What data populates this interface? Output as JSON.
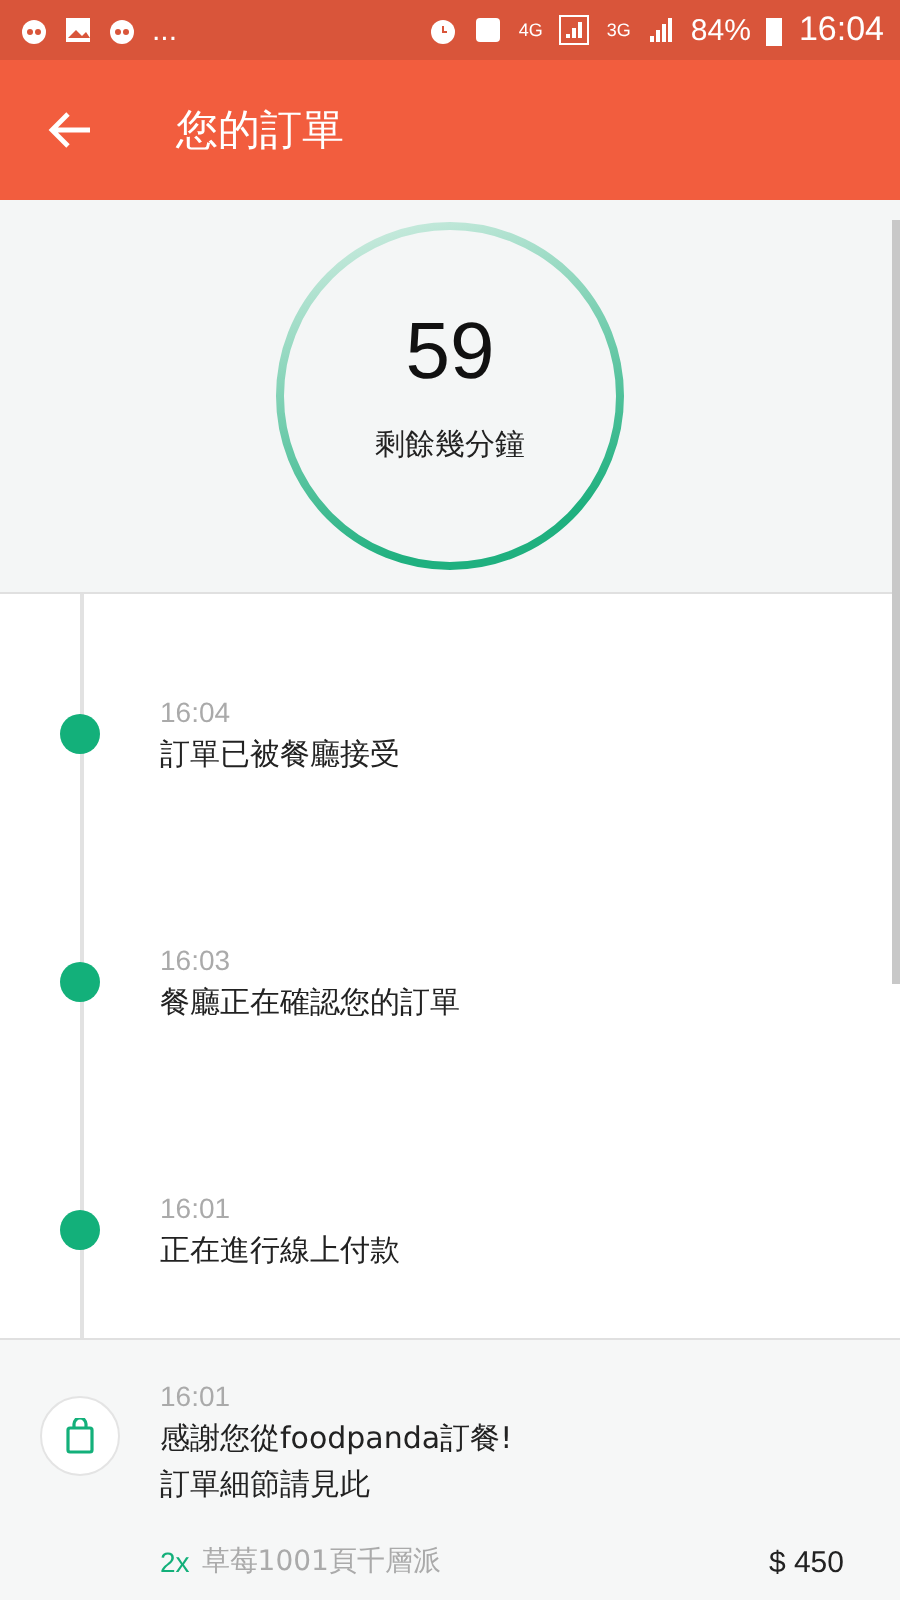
{
  "status_bar": {
    "overflow": "...",
    "network_4g": "4G",
    "network_3g": "3G",
    "battery": "84%",
    "time": "16:04"
  },
  "app_bar": {
    "title": "您的訂單"
  },
  "countdown": {
    "minutes": "59",
    "caption": "剩餘幾分鐘"
  },
  "timeline": [
    {
      "kind": "status",
      "time": "16:04",
      "text": "訂單已被餐廳接受"
    },
    {
      "kind": "status",
      "time": "16:03",
      "text": "餐廳正在確認您的訂單"
    },
    {
      "kind": "status",
      "time": "16:01",
      "text": "正在進行線上付款"
    },
    {
      "kind": "order",
      "time": "16:01",
      "lines": [
        "感謝您從foodpanda訂餐!",
        "訂單細節請見此"
      ],
      "items": [
        {
          "qty": "2x",
          "name": "草莓1001頁千層派",
          "price": "$ 450"
        }
      ]
    }
  ]
}
